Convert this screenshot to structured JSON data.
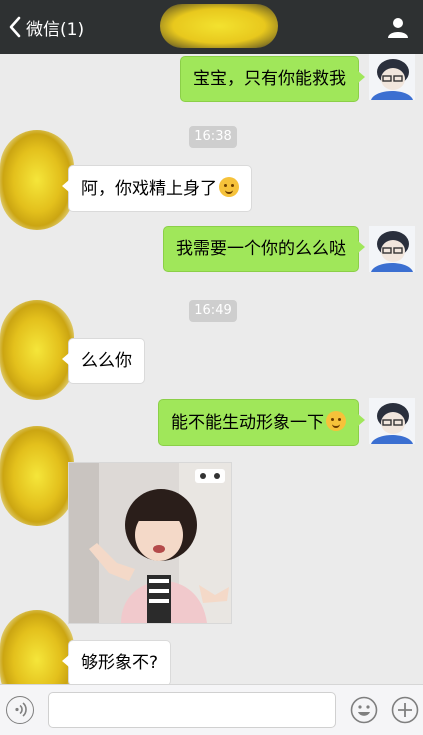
{
  "header": {
    "back_label": "微信(1)",
    "back_icon": "chevron-left-icon",
    "profile_icon": "person-icon"
  },
  "messages": [
    {
      "sender": "me",
      "type": "text",
      "text": "宝宝，只有你能救我"
    },
    {
      "type": "time",
      "text": "16:38"
    },
    {
      "sender": "other",
      "type": "text",
      "text": "阿，你戏精上身了",
      "emoji": "laughing-crying-emoji"
    },
    {
      "sender": "me",
      "type": "text",
      "text": "我需要一个你的么么哒"
    },
    {
      "type": "time",
      "text": "16:49"
    },
    {
      "sender": "other",
      "type": "text",
      "text": "么么你"
    },
    {
      "sender": "me",
      "type": "text",
      "text": "能不能生动形象一下",
      "emoji": "smirk-emoji"
    },
    {
      "sender": "other",
      "type": "image",
      "text": ""
    },
    {
      "sender": "other",
      "type": "text",
      "text": "够形象不?"
    }
  ],
  "input_bar": {
    "voice_icon": "voice-icon",
    "emoji_icon": "smiley-icon",
    "plus_icon": "plus-icon"
  },
  "colors": {
    "header_bg": "#2e3132",
    "chat_bg": "#ebebeb",
    "my_bubble": "#a0e75a",
    "other_bubble": "#ffffff",
    "timestamp_bg": "#cecece"
  }
}
